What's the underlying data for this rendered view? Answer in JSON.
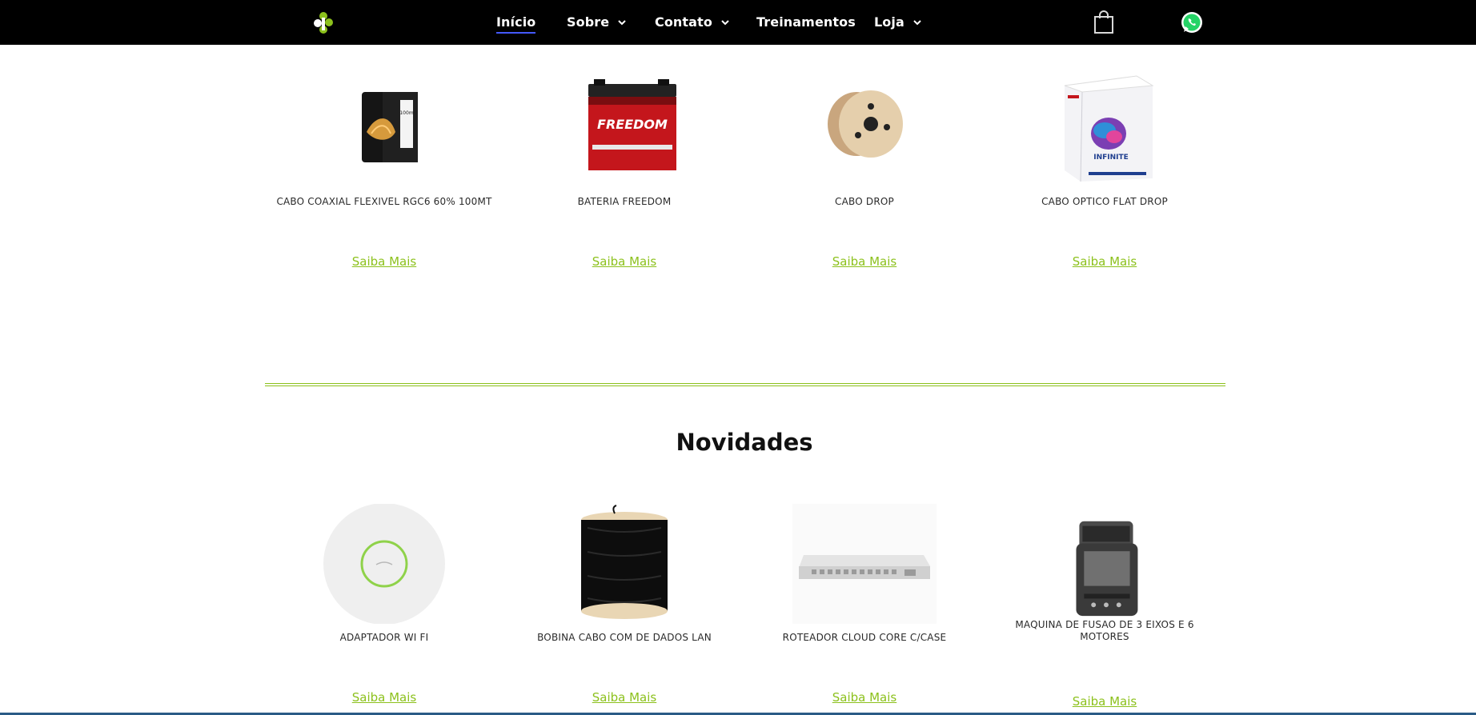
{
  "nav": {
    "items": [
      {
        "label": "Início",
        "active": true,
        "dropdown": false
      },
      {
        "label": "Sobre",
        "active": false,
        "dropdown": true
      },
      {
        "label": "Contato",
        "active": false,
        "dropdown": true
      },
      {
        "label": "Treinamentos",
        "active": false,
        "dropdown": false
      },
      {
        "label": "Loja",
        "active": false,
        "dropdown": true
      }
    ],
    "icons": {
      "logo": "logo-icon",
      "cart": "shopping-bag-icon",
      "whatsapp": "whatsapp-icon"
    }
  },
  "products": [
    {
      "name": "CABO COAXIAL FLEXIVEL RGC6 60% 100MT",
      "link": "Saiba Mais",
      "image": "coax-cable-box"
    },
    {
      "name": "BATERIA FREEDOM",
      "link": "Saiba Mais",
      "image": "car-battery",
      "image_text": "FREEDOM"
    },
    {
      "name": "CABO DROP",
      "link": "Saiba Mais",
      "image": "cable-reel"
    },
    {
      "name": "CABO OPTICO FLAT DROP",
      "link": "Saiba Mais",
      "image": "infinite-box",
      "image_text": "INFINITE"
    }
  ],
  "novidades": {
    "title": "Novidades",
    "products": [
      {
        "name": "ADAPTADOR WI FI",
        "link": "Saiba Mais",
        "image": "wifi-access-point"
      },
      {
        "name": "BOBINA CABO COM DE DADOS LAN",
        "link": "Saiba Mais",
        "image": "black-cable-spool"
      },
      {
        "name": "ROTEADOR CLOUD CORE C/CASE",
        "link": "Saiba Mais",
        "image": "rack-router"
      },
      {
        "name": "MAQUINA DE FUSAO DE 3 EIXOS E 6 MOTORES",
        "link": "Saiba Mais",
        "image": "fusion-splicer"
      }
    ]
  },
  "colors": {
    "topbar": "#000000",
    "accent_green": "#8cc11c",
    "active_underline": "#4459ff",
    "whatsapp_green": "#25d366"
  }
}
